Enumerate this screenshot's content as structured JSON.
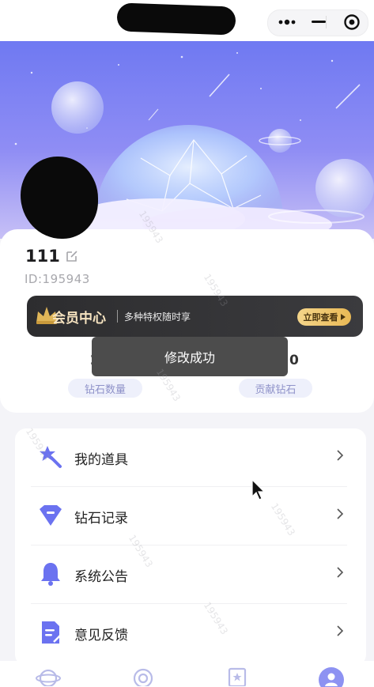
{
  "profile": {
    "username": "111",
    "user_id": "ID:195943"
  },
  "vip": {
    "title": "会员中心",
    "subtitle": "多种特权随时享",
    "button": "立即查看"
  },
  "stats": [
    {
      "value": "2",
      "label": "钻石数量"
    },
    {
      "value": "0",
      "label": "贡献钻石"
    }
  ],
  "toast": "修改成功",
  "menu": [
    {
      "label": "我的道具"
    },
    {
      "label": "钻石记录"
    },
    {
      "label": "系统公告"
    },
    {
      "label": "意见反馈"
    }
  ],
  "watermark": "195943",
  "colors": {
    "accent": "#6b72f0",
    "vip_gold": "#f6e3c0",
    "pill_bg": "#eef0fb"
  }
}
